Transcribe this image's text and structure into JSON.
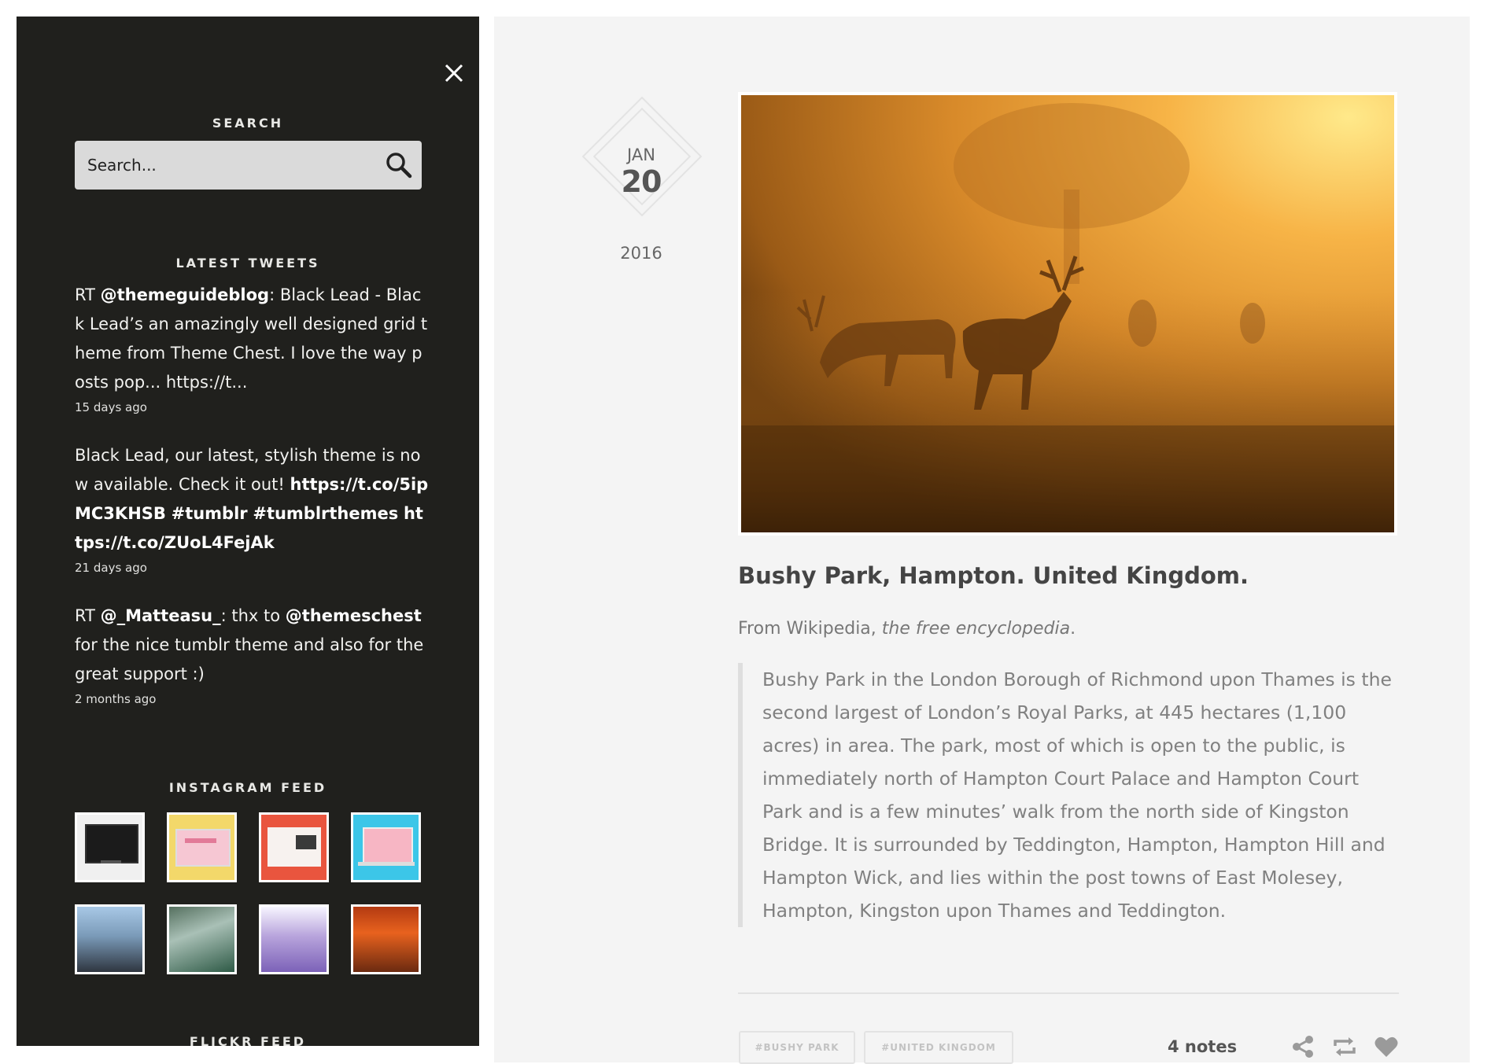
{
  "sidebar": {
    "search_title": "SEARCH",
    "search_placeholder": "Search...",
    "tweets_title": "LATEST TWEETS",
    "tweets": [
      {
        "parts": [
          "RT ",
          "@themeguideblog",
          ": Black Lead - Black Lead’s an amazingly well designed grid theme from Theme Chest. I love the way posts pop... https://t..."
        ],
        "time": "15 days ago"
      },
      {
        "parts": [
          "Black Lead, our latest, stylish theme is now available. Check it out! ",
          "https://t.co/5ipMC3KHSB",
          " ",
          "#tumblr",
          " ",
          "#tumblrthemes",
          " ",
          "https://t.co/ZUoL4FejAk"
        ],
        "time": "21 days ago"
      },
      {
        "parts": [
          "RT ",
          "@_Matteasu_",
          ": thx to ",
          "@themeschest",
          " for the nice tumblr theme and also for the great support :)"
        ],
        "time": "2 months ago"
      }
    ],
    "instagram_title": "INSTAGRAM FEED",
    "flickr_title": "FLICKR FEED"
  },
  "post": {
    "date": {
      "month": "JAN",
      "day": "20",
      "year": "2016"
    },
    "title_bold": "Bushy Park, Hampton.",
    "title_rest": " United Kingdom.",
    "source_prefix": "From Wikipedia, ",
    "source_italic": "the free encyclopedia",
    "source_suffix": ".",
    "quote": "Bushy Park in the London Borough of Richmond upon Thames is the second largest of London’s Royal Parks, at 445 hectares (1,100 acres) in area. The park, most of which is open to the public, is immediately north of Hampton Court Palace and Hampton Court Park and is a few minutes’ walk from the north side of Kingston Bridge. It is surrounded by Teddington, Hampton, Hampton Hill and Hampton Wick, and lies within the post towns of East Molesey, Hampton, Kingston upon Thames and Teddington.",
    "tags": [
      "#BUSHY PARK",
      "#UNITED KINGDOM"
    ],
    "notes": "4 notes"
  },
  "colors": {
    "sidebar_bg": "#20201d",
    "main_bg": "#f4f4f4",
    "icon_gray": "#9a9a9a"
  },
  "icons": [
    "close-icon",
    "search-icon",
    "share-icon",
    "reblog-icon",
    "heart-icon"
  ]
}
